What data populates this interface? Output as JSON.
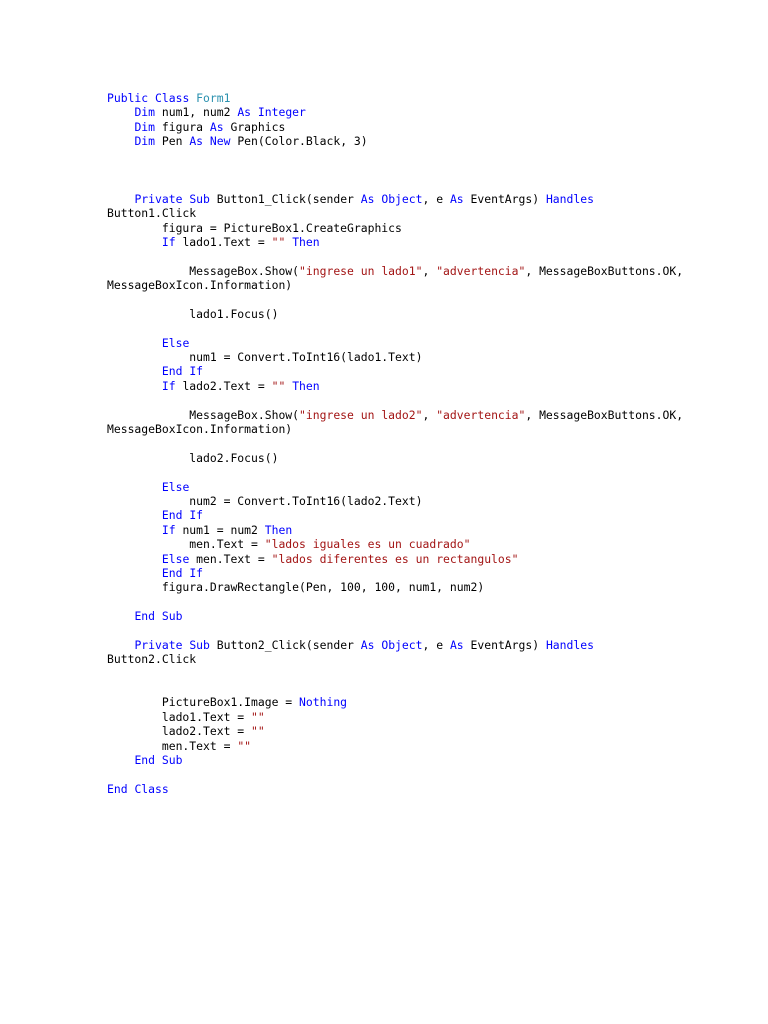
{
  "document": {
    "lines": [
      [
        {
          "t": "Public",
          "k": "kw"
        },
        {
          "t": " ",
          "k": "plain"
        },
        {
          "t": "Class",
          "k": "kw"
        },
        {
          "t": " ",
          "k": "plain"
        },
        {
          "t": "Form1",
          "k": "type"
        }
      ],
      [
        {
          "t": "    ",
          "k": "plain"
        },
        {
          "t": "Dim",
          "k": "kw"
        },
        {
          "t": " num1, num2 ",
          "k": "plain"
        },
        {
          "t": "As",
          "k": "kw"
        },
        {
          "t": " ",
          "k": "plain"
        },
        {
          "t": "Integer",
          "k": "kw"
        }
      ],
      [
        {
          "t": "    ",
          "k": "plain"
        },
        {
          "t": "Dim",
          "k": "kw"
        },
        {
          "t": " figura ",
          "k": "plain"
        },
        {
          "t": "As",
          "k": "kw"
        },
        {
          "t": " Graphics",
          "k": "plain"
        }
      ],
      [
        {
          "t": "    ",
          "k": "plain"
        },
        {
          "t": "Dim",
          "k": "kw"
        },
        {
          "t": " Pen ",
          "k": "plain"
        },
        {
          "t": "As",
          "k": "kw"
        },
        {
          "t": " ",
          "k": "plain"
        },
        {
          "t": "New",
          "k": "kw"
        },
        {
          "t": " Pen(Color.Black, 3)",
          "k": "plain"
        }
      ],
      [],
      [],
      [],
      [
        {
          "t": "    ",
          "k": "plain"
        },
        {
          "t": "Private",
          "k": "kw"
        },
        {
          "t": " ",
          "k": "plain"
        },
        {
          "t": "Sub",
          "k": "kw"
        },
        {
          "t": " Button1_Click(sender ",
          "k": "plain"
        },
        {
          "t": "As",
          "k": "kw"
        },
        {
          "t": " ",
          "k": "plain"
        },
        {
          "t": "Object",
          "k": "kw"
        },
        {
          "t": ", e ",
          "k": "plain"
        },
        {
          "t": "As",
          "k": "kw"
        },
        {
          "t": " EventArgs) ",
          "k": "plain"
        },
        {
          "t": "Handles",
          "k": "kw"
        }
      ],
      [
        {
          "t": "Button1.Click",
          "k": "plain"
        }
      ],
      [
        {
          "t": "        figura = PictureBox1.CreateGraphics",
          "k": "plain"
        }
      ],
      [
        {
          "t": "        ",
          "k": "plain"
        },
        {
          "t": "If",
          "k": "kw"
        },
        {
          "t": " lado1.Text = ",
          "k": "plain"
        },
        {
          "t": "\"\"",
          "k": "str"
        },
        {
          "t": " ",
          "k": "plain"
        },
        {
          "t": "Then",
          "k": "kw"
        }
      ],
      [],
      [
        {
          "t": "            MessageBox.Show(",
          "k": "plain"
        },
        {
          "t": "\"ingrese un lado1\"",
          "k": "str"
        },
        {
          "t": ", ",
          "k": "plain"
        },
        {
          "t": "\"advertencia\"",
          "k": "str"
        },
        {
          "t": ", MessageBoxButtons.OK,",
          "k": "plain"
        }
      ],
      [
        {
          "t": "MessageBoxIcon.Information)",
          "k": "plain"
        }
      ],
      [],
      [
        {
          "t": "            lado1.Focus()",
          "k": "plain"
        }
      ],
      [],
      [
        {
          "t": "        ",
          "k": "plain"
        },
        {
          "t": "Else",
          "k": "kw"
        }
      ],
      [
        {
          "t": "            num1 = Convert.ToInt16(lado1.Text)",
          "k": "plain"
        }
      ],
      [
        {
          "t": "        ",
          "k": "plain"
        },
        {
          "t": "End",
          "k": "kw"
        },
        {
          "t": " ",
          "k": "plain"
        },
        {
          "t": "If",
          "k": "kw"
        }
      ],
      [
        {
          "t": "        ",
          "k": "plain"
        },
        {
          "t": "If",
          "k": "kw"
        },
        {
          "t": " lado2.Text = ",
          "k": "plain"
        },
        {
          "t": "\"\"",
          "k": "str"
        },
        {
          "t": " ",
          "k": "plain"
        },
        {
          "t": "Then",
          "k": "kw"
        }
      ],
      [],
      [
        {
          "t": "            MessageBox.Show(",
          "k": "plain"
        },
        {
          "t": "\"ingrese un lado2\"",
          "k": "str"
        },
        {
          "t": ", ",
          "k": "plain"
        },
        {
          "t": "\"advertencia\"",
          "k": "str"
        },
        {
          "t": ", MessageBoxButtons.OK,",
          "k": "plain"
        }
      ],
      [
        {
          "t": "MessageBoxIcon.Information)",
          "k": "plain"
        }
      ],
      [],
      [
        {
          "t": "            lado2.Focus()",
          "k": "plain"
        }
      ],
      [],
      [
        {
          "t": "        ",
          "k": "plain"
        },
        {
          "t": "Else",
          "k": "kw"
        }
      ],
      [
        {
          "t": "            num2 = Convert.ToInt16(lado2.Text)",
          "k": "plain"
        }
      ],
      [
        {
          "t": "        ",
          "k": "plain"
        },
        {
          "t": "End",
          "k": "kw"
        },
        {
          "t": " ",
          "k": "plain"
        },
        {
          "t": "If",
          "k": "kw"
        }
      ],
      [
        {
          "t": "        ",
          "k": "plain"
        },
        {
          "t": "If",
          "k": "kw"
        },
        {
          "t": " num1 = num2 ",
          "k": "plain"
        },
        {
          "t": "Then",
          "k": "kw"
        }
      ],
      [
        {
          "t": "            men.Text = ",
          "k": "plain"
        },
        {
          "t": "\"lados iguales es un cuadrado\"",
          "k": "str"
        }
      ],
      [
        {
          "t": "        ",
          "k": "plain"
        },
        {
          "t": "Else",
          "k": "kw"
        },
        {
          "t": " men.Text = ",
          "k": "plain"
        },
        {
          "t": "\"lados diferentes es un rectangulos\"",
          "k": "str"
        }
      ],
      [
        {
          "t": "        ",
          "k": "plain"
        },
        {
          "t": "End",
          "k": "kw"
        },
        {
          "t": " ",
          "k": "plain"
        },
        {
          "t": "If",
          "k": "kw"
        }
      ],
      [
        {
          "t": "        figura.DrawRectangle(Pen, 100, 100, num1, num2)",
          "k": "plain"
        }
      ],
      [],
      [
        {
          "t": "    ",
          "k": "plain"
        },
        {
          "t": "End",
          "k": "kw"
        },
        {
          "t": " ",
          "k": "plain"
        },
        {
          "t": "Sub",
          "k": "kw"
        }
      ],
      [],
      [
        {
          "t": "    ",
          "k": "plain"
        },
        {
          "t": "Private",
          "k": "kw"
        },
        {
          "t": " ",
          "k": "plain"
        },
        {
          "t": "Sub",
          "k": "kw"
        },
        {
          "t": " Button2_Click(sender ",
          "k": "plain"
        },
        {
          "t": "As",
          "k": "kw"
        },
        {
          "t": " ",
          "k": "plain"
        },
        {
          "t": "Object",
          "k": "kw"
        },
        {
          "t": ", e ",
          "k": "plain"
        },
        {
          "t": "As",
          "k": "kw"
        },
        {
          "t": " EventArgs) ",
          "k": "plain"
        },
        {
          "t": "Handles",
          "k": "kw"
        }
      ],
      [
        {
          "t": "Button2.Click",
          "k": "plain"
        }
      ],
      [],
      [],
      [
        {
          "t": "        PictureBox1.Image = ",
          "k": "plain"
        },
        {
          "t": "Nothing",
          "k": "kw"
        }
      ],
      [
        {
          "t": "        lado1.Text = ",
          "k": "plain"
        },
        {
          "t": "\"\"",
          "k": "str"
        }
      ],
      [
        {
          "t": "        lado2.Text = ",
          "k": "plain"
        },
        {
          "t": "\"\"",
          "k": "str"
        }
      ],
      [
        {
          "t": "        men.Text = ",
          "k": "plain"
        },
        {
          "t": "\"\"",
          "k": "str"
        }
      ],
      [
        {
          "t": "    ",
          "k": "plain"
        },
        {
          "t": "End",
          "k": "kw"
        },
        {
          "t": " ",
          "k": "plain"
        },
        {
          "t": "Sub",
          "k": "kw"
        }
      ],
      [],
      [
        {
          "t": "End",
          "k": "kw"
        },
        {
          "t": " ",
          "k": "plain"
        },
        {
          "t": "Class",
          "k": "kw"
        }
      ]
    ]
  },
  "colors": {
    "background": "#ffffff",
    "keyword": "#0000ff",
    "string": "#a31515",
    "type_name": "#2b91af",
    "plain_text": "#000000"
  }
}
